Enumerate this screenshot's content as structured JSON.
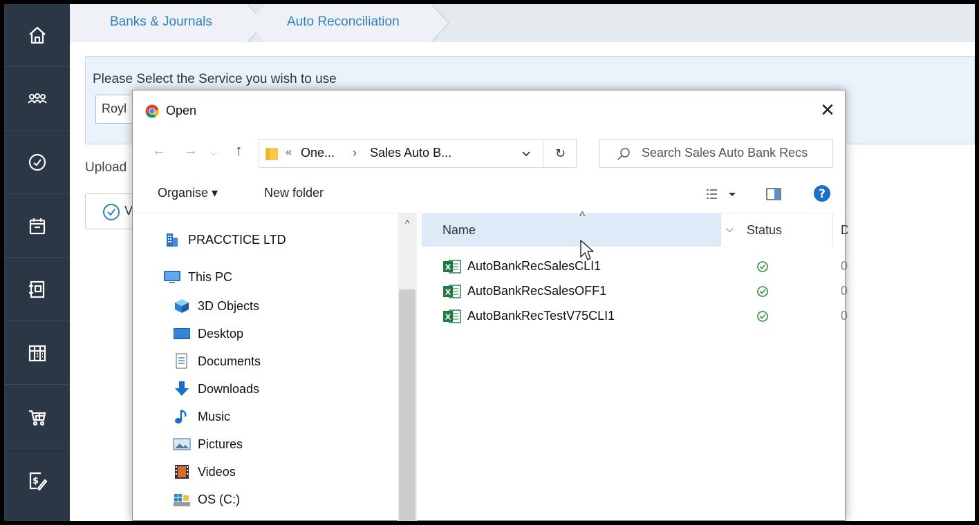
{
  "breadcrumb": {
    "items": [
      "Banks & Journals",
      "Auto Reconciliation"
    ]
  },
  "sidebar": {
    "items": [
      {
        "icon": "home-icon"
      },
      {
        "icon": "users-icon"
      },
      {
        "icon": "dashboard-icon"
      },
      {
        "icon": "calendar-icon"
      },
      {
        "icon": "document-icon"
      },
      {
        "icon": "ledger-icon"
      },
      {
        "icon": "basket-icon"
      },
      {
        "icon": "invoice-icon"
      }
    ]
  },
  "service": {
    "label": "Please Select the Service you wish to use",
    "selected": "Royl"
  },
  "upload": {
    "label": "Upload",
    "verify_label": "V"
  },
  "dialog": {
    "title": "Open",
    "close": "✕",
    "nav": {
      "back": "←",
      "forward": "→",
      "recent": "⌵",
      "up": "↑"
    },
    "address": {
      "lead": "«",
      "segments": [
        "One...",
        "Sales Auto B..."
      ],
      "separator": "›"
    },
    "search_placeholder": "Search Sales Auto Bank Recs",
    "toolbar": {
      "organise": "Organise ▾",
      "new_folder": "New folder"
    },
    "nav_pane": [
      {
        "label": "PRACCTICE LTD",
        "icon": "building-icon"
      },
      {
        "label": "This PC",
        "icon": "computer-icon"
      },
      {
        "label": "3D Objects",
        "icon": "cube-icon"
      },
      {
        "label": "Desktop",
        "icon": "desktop-icon"
      },
      {
        "label": "Documents",
        "icon": "documents-icon"
      },
      {
        "label": "Downloads",
        "icon": "download-icon"
      },
      {
        "label": "Music",
        "icon": "music-icon"
      },
      {
        "label": "Pictures",
        "icon": "pictures-icon"
      },
      {
        "label": "Videos",
        "icon": "videos-icon"
      },
      {
        "label": "OS (C:)",
        "icon": "drive-icon"
      }
    ],
    "columns": {
      "name": "Name",
      "status": "Status",
      "date": "D",
      "sort_caret": "^",
      "dropdown": "⌵"
    },
    "files": [
      {
        "name": "AutoBankRecSalesCLI1",
        "status": "synced-icon",
        "date": "0"
      },
      {
        "name": "AutoBankRecSalesOFF1",
        "status": "synced-icon",
        "date": "0"
      },
      {
        "name": "AutoBankRecTestV75CLI1",
        "status": "synced-icon",
        "date": "0"
      }
    ]
  },
  "colors": {
    "sidebar": "#2b3744",
    "accent": "#2f7fc1",
    "excel": "#1d7a45",
    "header_hover": "#dcebf7"
  }
}
